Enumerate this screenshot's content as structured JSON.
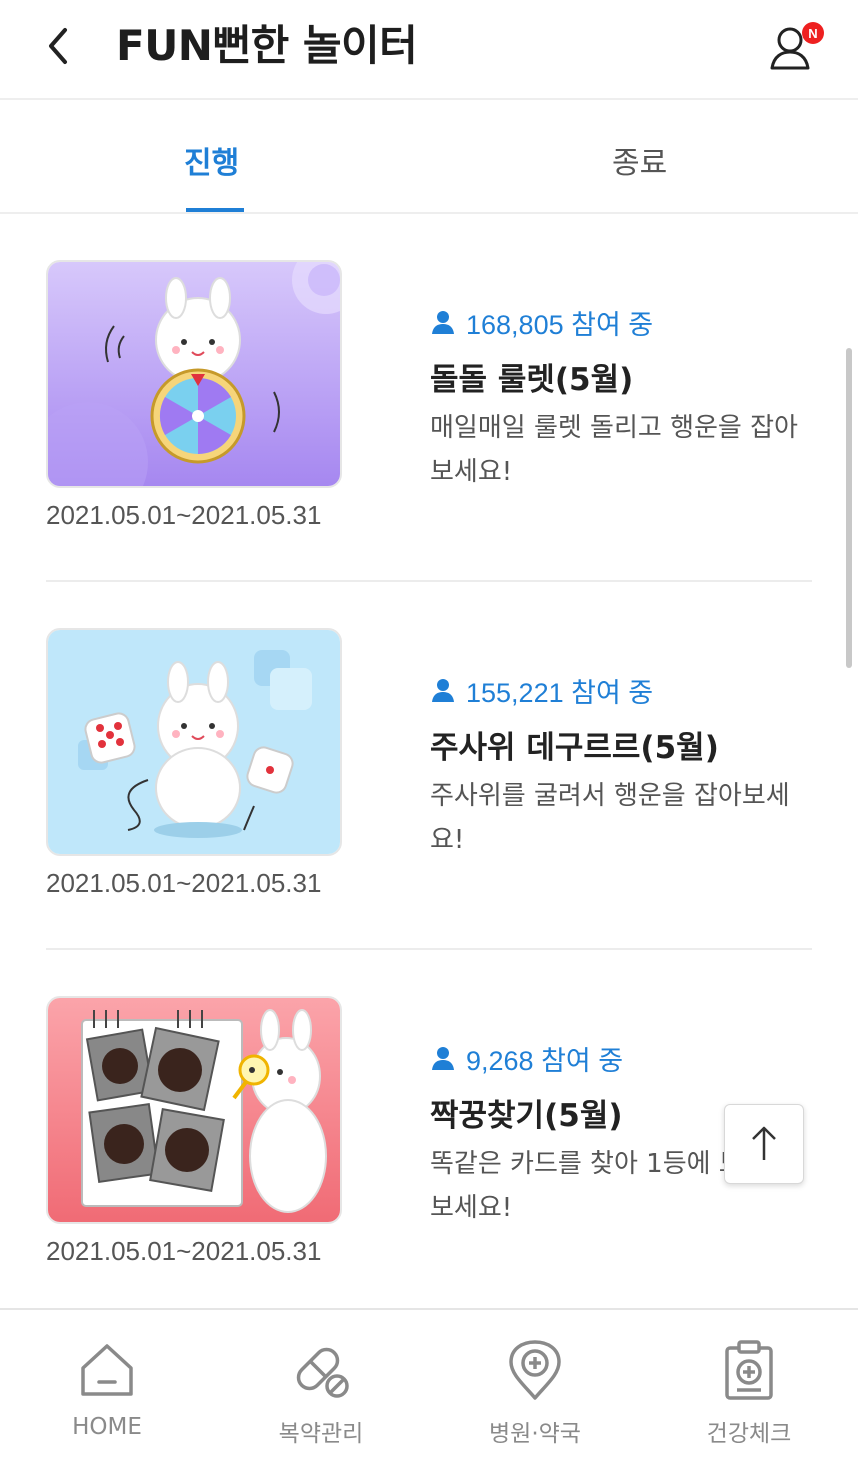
{
  "header": {
    "title": "FUN뻔한 놀이터",
    "badge": "N"
  },
  "tabs": [
    {
      "label": "진행",
      "active": true
    },
    {
      "label": "종료",
      "active": false
    }
  ],
  "items": [
    {
      "participants": "168,805 참여 중",
      "title": "돌돌 룰렛(5월)",
      "description": "매일매일 룰렛 돌리고 행운을 잡아보세요!",
      "date": "2021.05.01~2021.05.31",
      "thumb_color": "#b69af3"
    },
    {
      "participants": "155,221 참여 중",
      "title": "주사위 데구르르(5월)",
      "description": "주사위를 굴려서 행운을 잡아보세요!",
      "date": "2021.05.01~2021.05.31",
      "thumb_color": "#bfe7fa"
    },
    {
      "participants": "9,268 참여 중",
      "title": "짝꿍찾기(5월)",
      "description": "똑같은 카드를 찾아 1등에 도전해보세요!",
      "date": "2021.05.01~2021.05.31",
      "thumb_color": "#f57f86"
    }
  ],
  "bottom_nav": [
    {
      "label": "HOME",
      "icon": "home-icon"
    },
    {
      "label": "복약관리",
      "icon": "pill-icon"
    },
    {
      "label": "병원·약국",
      "icon": "location-pin-plus-icon"
    },
    {
      "label": "건강체크",
      "icon": "clipboard-plus-icon"
    }
  ],
  "colors": {
    "accent": "#1f7fd6",
    "badge": "#ee2020"
  }
}
